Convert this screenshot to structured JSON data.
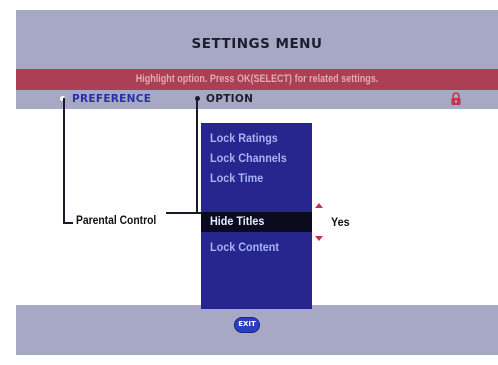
{
  "menu": {
    "title": "SETTINGS MENU",
    "hint": "Highlight option. Press OK(SELECT) for related settings."
  },
  "columns": {
    "preference_label": "PREFERENCE",
    "option_label": "OPTION"
  },
  "preference": {
    "current": "Parental Control"
  },
  "options": [
    {
      "label": "Lock Ratings",
      "selected": false
    },
    {
      "label": "Lock Channels",
      "selected": false
    },
    {
      "label": "Lock Time",
      "selected": false
    },
    {
      "label": "Hide Titles",
      "selected": true
    },
    {
      "label": "Lock  Content",
      "selected": false
    }
  ],
  "value": {
    "current": "Yes"
  },
  "footer": {
    "exit_label": "EXIT"
  },
  "icons": {
    "lock": "lock-icon",
    "scroll_up": "arrow-up-icon",
    "scroll_down": "arrow-down-icon"
  },
  "colors": {
    "frame": "#a7a8c4",
    "hint_bar": "#aa3f55",
    "option_list": "#27268f",
    "option_selected": "#0b0b20",
    "preference_label": "#2a2ea8",
    "arrows": "#c23552",
    "exit_button": "#2b3ec2"
  }
}
